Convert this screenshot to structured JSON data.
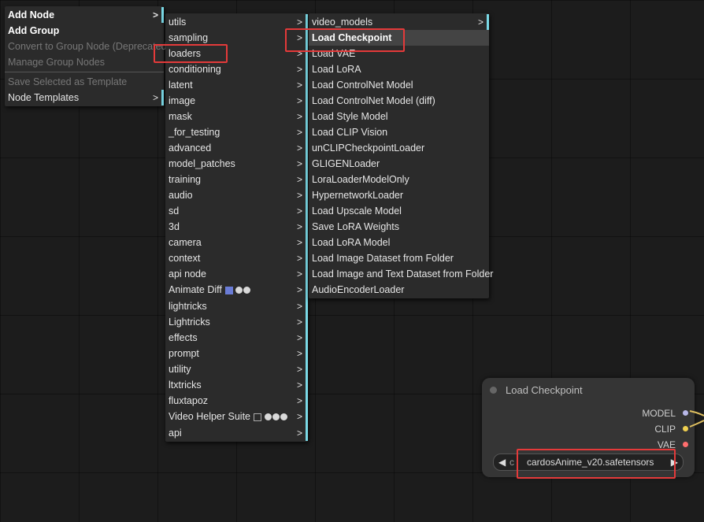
{
  "menu1": [
    {
      "label": "Add Node",
      "sub": true,
      "style": "bold"
    },
    {
      "label": "Add Group",
      "sub": false,
      "style": "bold"
    },
    {
      "label": "Convert to Group Node (Deprecated)",
      "sub": false,
      "style": "disabled"
    },
    {
      "label": "Manage Group Nodes",
      "sub": false,
      "style": "disabled"
    },
    {
      "sep": true
    },
    {
      "label": "Save Selected as Template",
      "sub": false,
      "style": "disabled"
    },
    {
      "label": "Node Templates",
      "sub": true,
      "style": "normal"
    }
  ],
  "menu2": [
    {
      "label": "utils"
    },
    {
      "label": "sampling"
    },
    {
      "label": "loaders",
      "boxed": true
    },
    {
      "label": "conditioning"
    },
    {
      "label": "latent"
    },
    {
      "label": "image"
    },
    {
      "label": "mask"
    },
    {
      "label": "_for_testing"
    },
    {
      "label": "advanced"
    },
    {
      "label": "model_patches"
    },
    {
      "label": "training"
    },
    {
      "label": "audio"
    },
    {
      "label": "sd"
    },
    {
      "label": "3d"
    },
    {
      "label": "camera"
    },
    {
      "label": "context"
    },
    {
      "label": "api node"
    },
    {
      "label": "Animate Diff",
      "badge": "ad"
    },
    {
      "label": "lightricks"
    },
    {
      "label": "Lightricks"
    },
    {
      "label": "effects"
    },
    {
      "label": "prompt"
    },
    {
      "label": "utility"
    },
    {
      "label": "ltxtricks"
    },
    {
      "label": "fluxtapoz"
    },
    {
      "label": "Video Helper Suite",
      "badge": "vhs"
    },
    {
      "label": "api"
    }
  ],
  "menu3": [
    {
      "label": "video_models",
      "sub": true
    },
    {
      "label": "Load Checkpoint",
      "highlight": true
    },
    {
      "label": "Load VAE"
    },
    {
      "label": "Load LoRA"
    },
    {
      "label": "Load ControlNet Model"
    },
    {
      "label": "Load ControlNet Model (diff)"
    },
    {
      "label": "Load Style Model"
    },
    {
      "label": "Load CLIP Vision"
    },
    {
      "label": "unCLIPCheckpointLoader"
    },
    {
      "label": "GLIGENLoader"
    },
    {
      "label": "LoraLoaderModelOnly"
    },
    {
      "label": "HypernetworkLoader"
    },
    {
      "label": "Load Upscale Model"
    },
    {
      "label": "Save LoRA Weights"
    },
    {
      "label": "Load LoRA Model"
    },
    {
      "label": "Load Image Dataset from Folder"
    },
    {
      "label": "Load Image and Text Dataset from Folder"
    },
    {
      "label": "AudioEncoderLoader"
    }
  ],
  "arrow": ">",
  "node": {
    "title": "Load Checkpoint",
    "outputs": [
      {
        "label": "MODEL",
        "color": "#b8b8e8"
      },
      {
        "label": "CLIP",
        "color": "#f0d050"
      },
      {
        "label": "VAE",
        "color": "#ff6e6e"
      }
    ],
    "widget_prefix": "c",
    "widget_value": "cardosAnime_v20.safetensors"
  }
}
